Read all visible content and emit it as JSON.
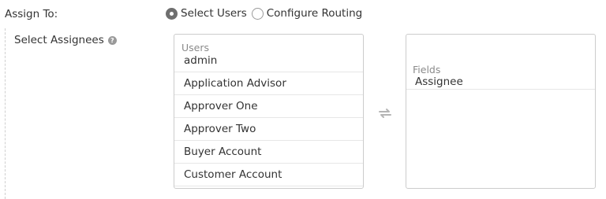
{
  "assign_to": {
    "label": "Assign To:",
    "options": [
      {
        "label": "Select Users",
        "checked": true
      },
      {
        "label": "Configure Routing",
        "checked": false
      }
    ]
  },
  "select_assignees": {
    "label": "Select Assignees",
    "help_icon": "question-circle-icon"
  },
  "users_list": {
    "header": "Users",
    "items": [
      "admin",
      "Application Advisor",
      "Approver One",
      "Approver Two",
      "Buyer Account",
      "Customer Account"
    ]
  },
  "transfer_icon": "swap-arrows-icon",
  "fields_list": {
    "header": "Fields",
    "items": [
      "Assignee"
    ]
  }
}
